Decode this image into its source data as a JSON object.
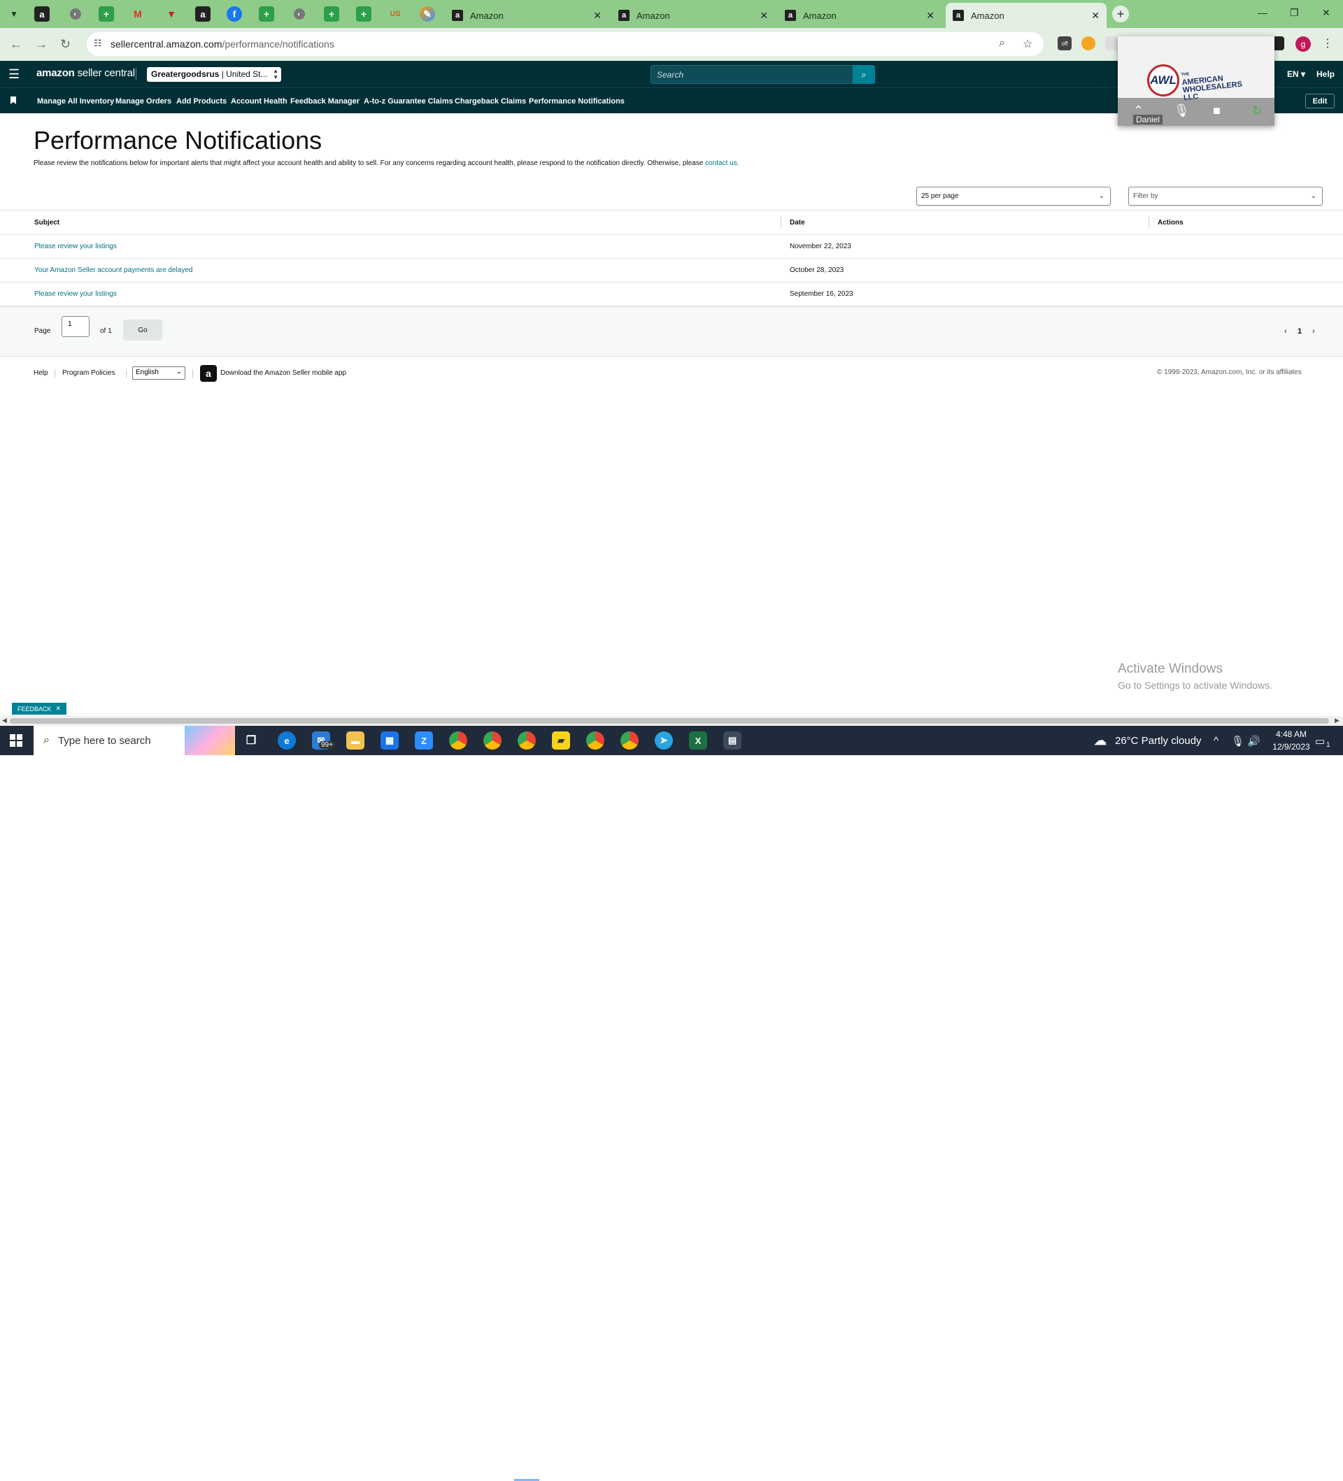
{
  "browser": {
    "tabs": [
      {
        "title": "Amazon",
        "active": false
      },
      {
        "title": "Amazon",
        "active": false
      },
      {
        "title": "Amazon",
        "active": false
      },
      {
        "title": "Amazon",
        "active": true
      }
    ],
    "url_host": "sellercentral.amazon.com",
    "url_path": "/performance/notifications"
  },
  "header": {
    "logo_bold": "amazon",
    "logo_light": " seller central",
    "store_name": "Greatergoodsrus",
    "store_region": " | United St...",
    "search_placeholder": "Search",
    "lang": "EN",
    "help": "Help"
  },
  "nav": {
    "items": [
      "Manage All Inventory",
      "Manage Orders",
      "Add Products",
      "Account Health",
      "Feedback Manager",
      "A-to-z Guarantee Claims",
      "Chargeback Claims",
      "Performance Notifications"
    ],
    "edit": "Edit"
  },
  "video_overlay": {
    "logo_mark": "AWL",
    "logo_line_small": "THE",
    "logo_line1": "AMERICAN",
    "logo_line2": "WHOLESALERS",
    "logo_line3": "LLC",
    "participant": "Daniel"
  },
  "page": {
    "title": "Performance Notifications",
    "description": "Please review the notifications below for important alerts that might affect your account health and ability to sell. For any concerns regarding account health, please respond to the notification directly. Otherwise, please ",
    "contact_link": "contact us.",
    "per_page": "25 per page",
    "filter": "Filter by"
  },
  "table": {
    "columns": [
      "Subject",
      "Date",
      "Actions"
    ],
    "rows": [
      {
        "subject": "Please review your listings",
        "date": "November 22, 2023"
      },
      {
        "subject": "Your Amazon Seller account payments are delayed",
        "date": "October 28, 2023"
      },
      {
        "subject": "Please review your listings",
        "date": "September 16, 2023"
      }
    ]
  },
  "pager": {
    "page_label": "Page",
    "page_value": "1",
    "of_label": "of 1",
    "go": "Go",
    "current": "1"
  },
  "footer": {
    "help": "Help",
    "policies": "Program Policies",
    "language": "English",
    "app": "Download the Amazon Seller mobile app",
    "copyright": "© 1999-2023, Amazon.com, Inc. or its affiliates"
  },
  "watermark": {
    "line1": "Activate Windows",
    "line2": "Go to Settings to activate Windows."
  },
  "feedback": "FEEDBACK",
  "taskbar": {
    "search_placeholder": "Type here to search",
    "mail_badge": "99+",
    "weather": "26°C  Partly cloudy",
    "time": "4:48 AM",
    "date": "12/9/2023",
    "notif_count": "1"
  }
}
